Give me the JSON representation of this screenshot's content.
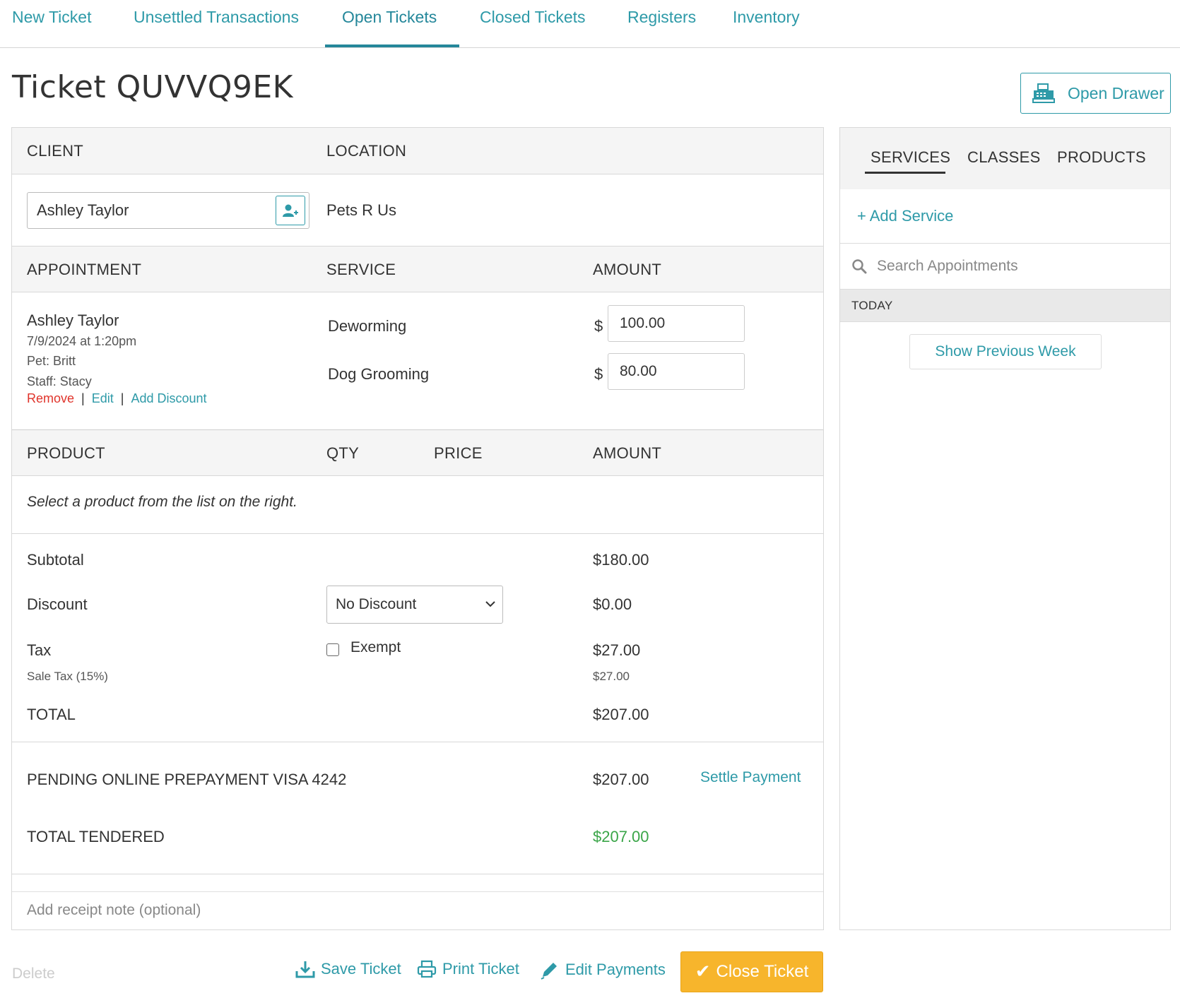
{
  "nav": {
    "tabs": [
      {
        "label": "New Ticket"
      },
      {
        "label": "Unsettled Transactions"
      },
      {
        "label": "Open Tickets"
      },
      {
        "label": "Closed Tickets"
      },
      {
        "label": "Registers"
      },
      {
        "label": "Inventory"
      }
    ],
    "active_tab": "Open Tickets"
  },
  "header": {
    "title": "Ticket QUVVQ9EK",
    "open_drawer_label": "Open Drawer"
  },
  "client_section": {
    "client_header": "CLIENT",
    "location_header": "LOCATION",
    "client_value": "Ashley Taylor",
    "location_value": "Pets R Us"
  },
  "appointment_section": {
    "headers": {
      "appointment": "APPOINTMENT",
      "service": "SERVICE",
      "amount": "AMOUNT"
    },
    "client_name": "Ashley Taylor",
    "datetime": "7/9/2024 at 1:20pm",
    "pet": "Pet: Britt",
    "staff": "Staff: Stacy",
    "actions": {
      "remove": "Remove",
      "edit": "Edit",
      "add_discount": "Add Discount",
      "separator": "|"
    },
    "currency_symbol": "$",
    "services": [
      {
        "name": "Deworming",
        "amount": "100.00"
      },
      {
        "name": "Dog Grooming",
        "amount": "80.00"
      }
    ]
  },
  "product_section": {
    "headers": {
      "product": "PRODUCT",
      "qty": "QTY",
      "price": "PRICE",
      "amount": "AMOUNT"
    },
    "empty_hint": "Select a product from the list on the right."
  },
  "totals": {
    "subtotal_label": "Subtotal",
    "subtotal_value": "$180.00",
    "discount_label": "Discount",
    "discount_selected": "No Discount",
    "discount_value": "$0.00",
    "tax_label": "Tax",
    "exempt_label": "Exempt",
    "exempt_checked": false,
    "tax_value": "$27.00",
    "sale_tax_label": "Sale Tax (15%)",
    "sale_tax_value": "$27.00",
    "total_label": "TOTAL",
    "total_value": "$207.00"
  },
  "payments": {
    "pending_label": "PENDING ONLINE PREPAYMENT VISA 4242",
    "pending_value": "$207.00",
    "settle_label": "Settle Payment",
    "tendered_label": "TOTAL TENDERED",
    "tendered_value": "$207.00",
    "tendered_color": "#3aa548"
  },
  "receipt_note": {
    "placeholder": "Add receipt note (optional)"
  },
  "right_panel": {
    "tabs": [
      {
        "label": "SERVICES"
      },
      {
        "label": "CLASSES"
      },
      {
        "label": "PRODUCTS"
      }
    ],
    "active_tab": "SERVICES",
    "add_service_label": "+ Add Service",
    "search_placeholder": "Search Appointments",
    "today_label": "TODAY",
    "show_previous_week_label": "Show Previous Week"
  },
  "footer": {
    "delete_label": "Delete",
    "save_label": "Save Ticket",
    "print_label": "Print Ticket",
    "edit_payments_label": "Edit Payments",
    "close_label": "Close Ticket"
  },
  "colors": {
    "accent": "#2e9aa8",
    "danger": "#e0342b",
    "close_button": "#f7b52c",
    "success": "#3aa548"
  },
  "icons": [
    "cash-register-icon",
    "add-user-icon",
    "chevron-down-icon",
    "search-icon",
    "download-icon",
    "printer-icon",
    "pencil-icon",
    "checkmark-icon"
  ]
}
